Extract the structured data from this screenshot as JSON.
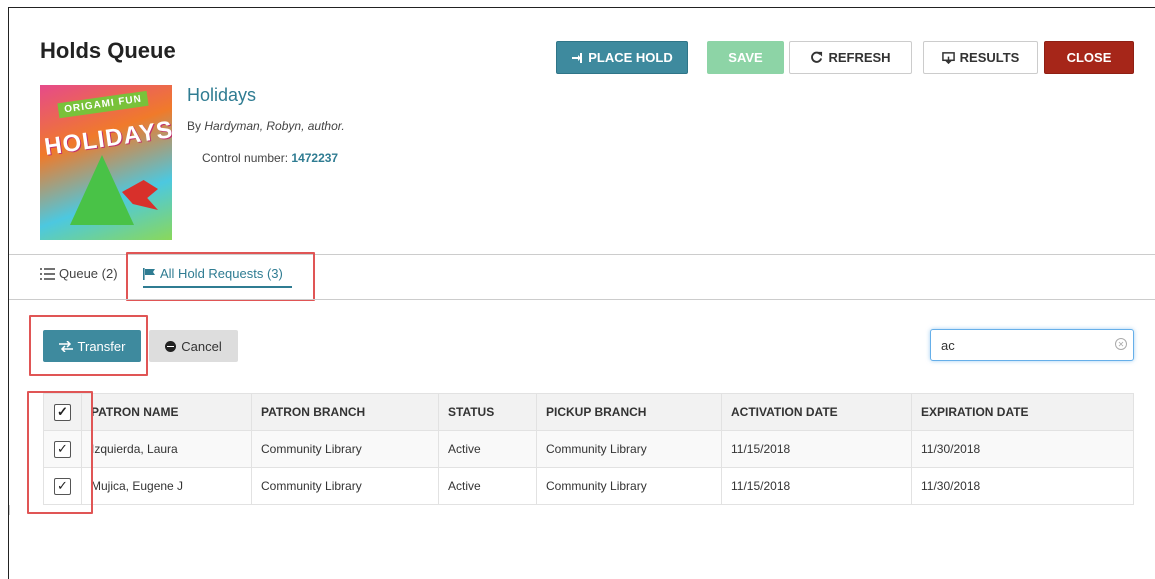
{
  "page": {
    "title": "Holds Queue"
  },
  "toolbar": {
    "place_hold": "PLACE HOLD",
    "save": "SAVE",
    "refresh": "REFRESH",
    "results": "RESULTS",
    "close": "CLOSE"
  },
  "book": {
    "cover": {
      "banner": "ORIGAMI FUN",
      "title": "HOLIDAYS"
    },
    "title": "Holidays",
    "by_prefix": "By",
    "author": "Hardyman, Robyn, author.",
    "control_label": "Control number:",
    "control_number": "1472237"
  },
  "tabs": [
    {
      "label": "Queue (2)",
      "icon": "list-icon"
    },
    {
      "label": "All Hold Requests (3)",
      "icon": "flag-icon",
      "active": true
    }
  ],
  "actions": {
    "transfer": "Transfer",
    "cancel": "Cancel"
  },
  "search": {
    "value": "ac",
    "clear_icon": "clear-circle-icon"
  },
  "table": {
    "headers": [
      "PATRON NAME",
      "PATRON BRANCH",
      "STATUS",
      "PICKUP BRANCH",
      "ACTIVATION DATE",
      "EXPIRATION DATE"
    ],
    "rows": [
      {
        "checked": true,
        "patron_name": "Izquierda, Laura",
        "patron_branch": "Community Library",
        "status": "Active",
        "pickup_branch": "Community Library",
        "activation_date": "11/15/2018",
        "expiration_date": "11/30/2018"
      },
      {
        "checked": true,
        "patron_name": "Mujica, Eugene J",
        "patron_branch": "Community Library",
        "status": "Active",
        "pickup_branch": "Community Library",
        "activation_date": "11/15/2018",
        "expiration_date": "11/30/2018"
      }
    ]
  },
  "colors": {
    "primary": "#3e8a9e",
    "save": "#8dd4a6",
    "close": "#a62619",
    "link": "#2f7c92",
    "highlight": "#e05555"
  }
}
